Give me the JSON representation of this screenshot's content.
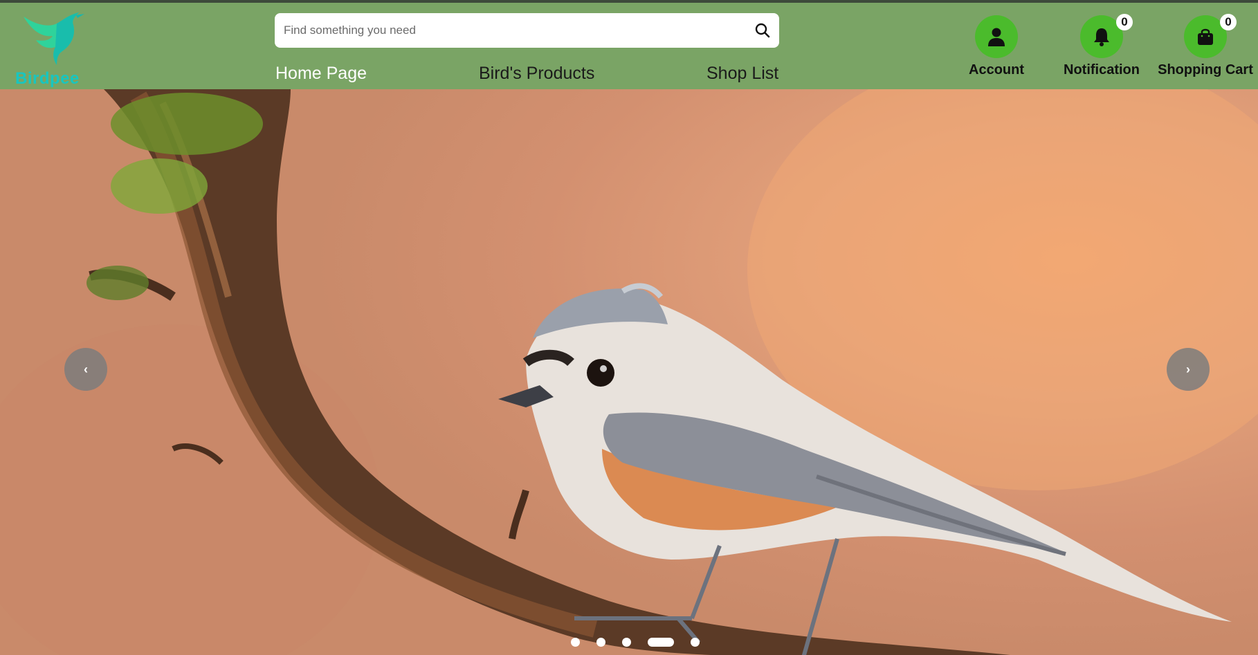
{
  "brand": {
    "name": "Birdpee",
    "logo_icon": "hummingbird-logo-icon"
  },
  "search": {
    "placeholder": "Find something you need",
    "value": "",
    "icon": "search-icon"
  },
  "nav": {
    "items": [
      {
        "label": "Home Page",
        "active": true
      },
      {
        "label": "Bird's Products",
        "active": false
      },
      {
        "label": "Shop List",
        "active": false
      }
    ]
  },
  "header_actions": {
    "account": {
      "label": "Account",
      "icon": "user-icon"
    },
    "notification": {
      "label": "Notification",
      "icon": "bell-icon",
      "count": "0"
    },
    "cart": {
      "label": "Shopping Cart",
      "icon": "shopping-bag-icon",
      "count": "0"
    }
  },
  "carousel": {
    "prev_icon": "chevron-left-icon",
    "next_icon": "chevron-right-icon",
    "prev_glyph": "‹",
    "next_glyph": "›",
    "slide_count": 5,
    "active_slide": 4
  },
  "colors": {
    "header_bg": "#7aa465",
    "action_circle": "#4bbb2c",
    "brand_text": "#18c6c0",
    "active_nav": "#ffffff"
  }
}
